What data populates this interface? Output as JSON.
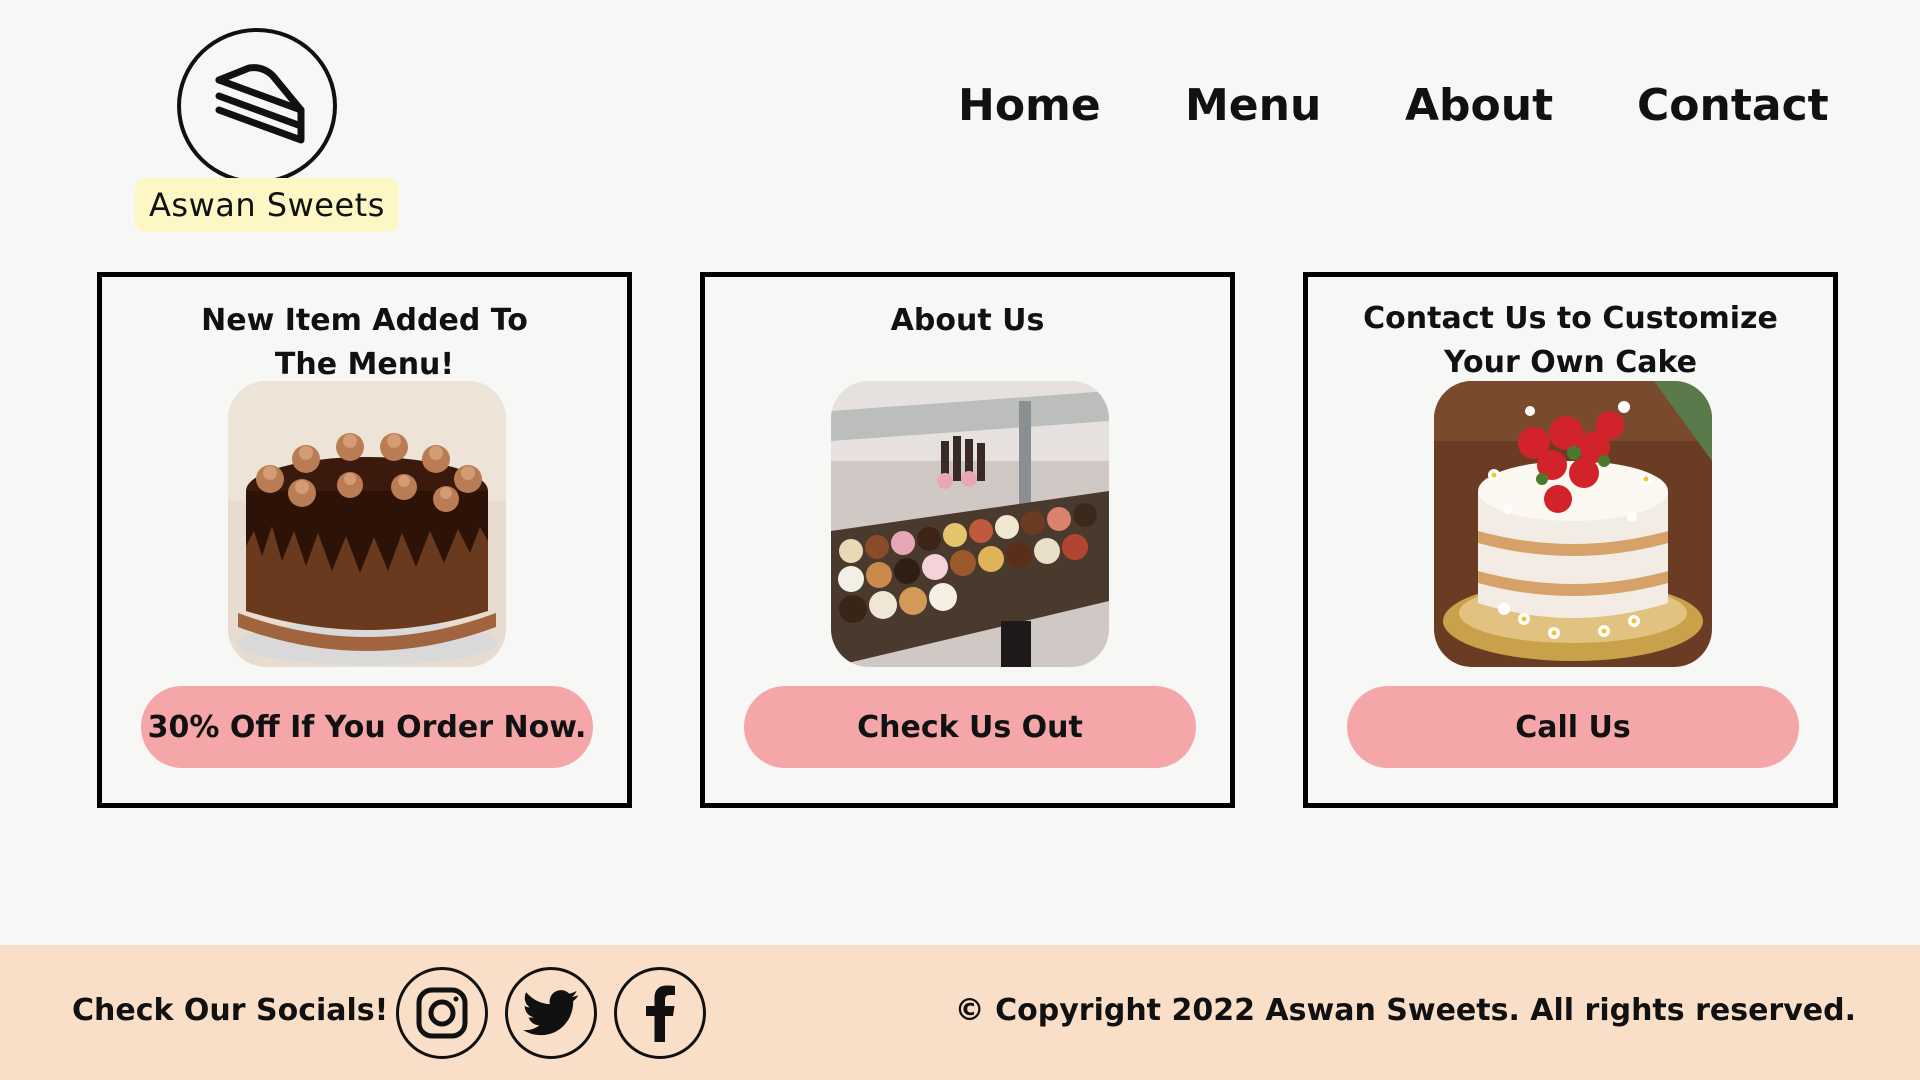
{
  "brand": {
    "name": "Aswan Sweets",
    "logo_icon": "cake-slice-icon"
  },
  "nav": {
    "items": [
      "Home",
      "Menu",
      "About",
      "Contact"
    ]
  },
  "cards": [
    {
      "title_line1": "New Item Added To",
      "title_line2": "The Menu!",
      "image": "chocolate-drip-cake",
      "button": "30% Off If You Order Now."
    },
    {
      "title_line1": "About Us",
      "title_line2": "",
      "image": "bakery-display-case",
      "button": "Check Us Out"
    },
    {
      "title_line1": "Contact Us to Customize",
      "title_line2": "Your Own Cake",
      "image": "strawberry-naked-cake",
      "button": "Call Us"
    }
  ],
  "footer": {
    "socials_label": "Check Our Socials!",
    "socials": [
      "instagram-icon",
      "twitter-icon",
      "facebook-icon"
    ],
    "copyright": "© Copyright 2022 Aswan Sweets. All rights reserved."
  },
  "colors": {
    "background": "#f7f7f6",
    "button": "#f5a6a8",
    "footer": "#fadfc8",
    "brand_highlight": "#fdf7c6"
  }
}
